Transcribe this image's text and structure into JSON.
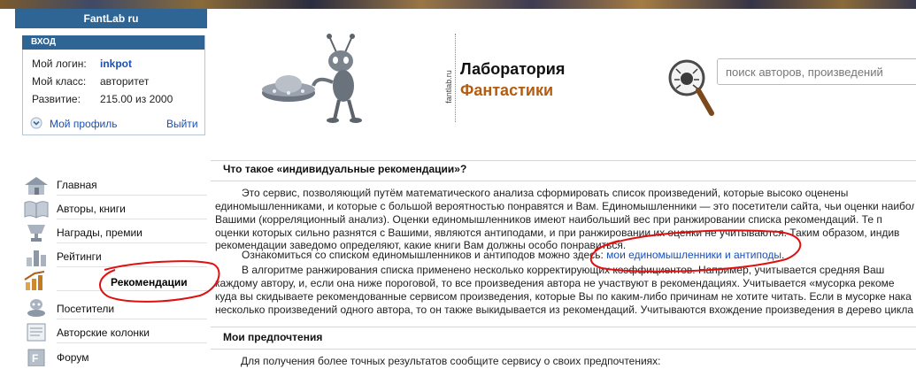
{
  "header": {
    "site_name": "FantLab ru"
  },
  "login": {
    "title": "ВХОД",
    "login_label": "Мой логин:",
    "login_value": "inkpot",
    "class_label": "Мой класс:",
    "class_value": "авторитет",
    "dev_label": "Развитие:",
    "dev_value": "215.00 из 2000",
    "profile_link": "Мой профиль",
    "logout_link": "Выйти"
  },
  "logo": {
    "site_tag": "fantlab.ru",
    "line1": "Лаборатория",
    "line2": "Фантастики"
  },
  "search": {
    "placeholder": "поиск авторов, произведений"
  },
  "nav": {
    "items": [
      {
        "label": "Главная",
        "icon": "house-icon"
      },
      {
        "label": "Авторы, книги",
        "icon": "book-icon"
      },
      {
        "label": "Награды, премии",
        "icon": "trophy-icon"
      },
      {
        "label": "Рейтинги",
        "icon": "bar-chart-icon"
      },
      {
        "label": "Рекомендации",
        "icon": "chart-arrow-icon"
      },
      {
        "label": "Посетители",
        "icon": "visitor-icon"
      },
      {
        "label": "Авторские колонки",
        "icon": "newspaper-icon"
      },
      {
        "label": "Форум",
        "icon": "forum-icon"
      }
    ]
  },
  "content": {
    "section1_title": "Что такое «индивидуальные рекомендации»?",
    "p1": [
      "Это сервис, позволяющий путём математического анализа сформировать список произведений, которые высоко оценены",
      "единомышленниками, и которые с большой вероятностью понравятся и Вам. Единомышленники — это посетители сайта, чьи оценки наиболее",
      "Вашими (корреляционный анализ). Оценки единомышленников имеют наибольший вес при ранжировании списка рекомендаций. Те п",
      "оценки которых сильно разнятся с Вашими, являются антиподами, и при ранжировании их оценки не учитываются. Таким образом, индив",
      "рекомендации заведомо определяют, какие книги Вам должны особо понравиться."
    ],
    "p2_prefix": "Ознакомиться со списком единомышленников и антиподов можно здесь:",
    "p2_link": "мои единомышленники и антиподы",
    "p2_suffix": ".",
    "p3": [
      "В алгоритме ранжирования списка применено несколько корректирующих коэффициентов. Например, учитывается средняя Ваш",
      "каждому автору, и, если она ниже пороговой, то все произведения автора не участвуют в рекомендациях. Учитывается «мусорка рекоме",
      "куда вы скидываете рекомендованные сервисом произведения, которые Вы по каким-либо причинам не хотите читать. Если в мусорке нака",
      "несколько произведений одного автора, то он также выкидывается из рекомендаций. Учитываются вхождение произведения в дерево цикла"
    ],
    "section2_title": "Мои предпочтения",
    "pref_text": "Для получения более точных результатов сообщите сервису о своих предпочтениях:"
  },
  "colors": {
    "header_blue": "#2f6595",
    "link_blue": "#1a4fb6",
    "brand_orange": "#b35c12",
    "annotation_red": "#e01010"
  }
}
